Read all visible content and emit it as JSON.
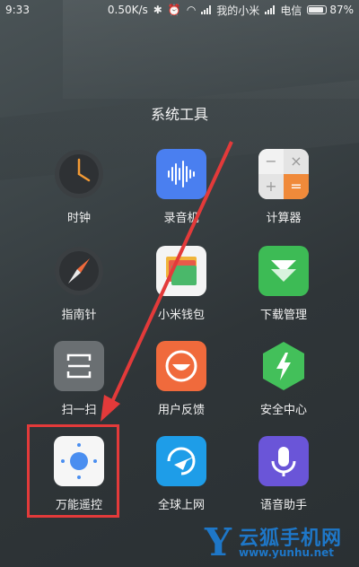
{
  "status": {
    "time": "9:33",
    "speed": "0.50K/s",
    "carrier1": "我的小米",
    "carrier2": "电信",
    "battery": "87%",
    "battery_level": 87
  },
  "folder": {
    "title": "系统工具"
  },
  "apps": [
    {
      "label": "时钟",
      "icon": "clock-icon"
    },
    {
      "label": "录音机",
      "icon": "recorder-icon"
    },
    {
      "label": "计算器",
      "icon": "calculator-icon"
    },
    {
      "label": "指南针",
      "icon": "compass-icon"
    },
    {
      "label": "小米钱包",
      "icon": "wallet-icon"
    },
    {
      "label": "下载管理",
      "icon": "download-icon"
    },
    {
      "label": "扫一扫",
      "icon": "scan-icon"
    },
    {
      "label": "用户反馈",
      "icon": "feedback-icon"
    },
    {
      "label": "安全中心",
      "icon": "security-icon"
    },
    {
      "label": "万能遥控",
      "icon": "remote-control-icon"
    },
    {
      "label": "全球上网",
      "icon": "global-internet-icon"
    },
    {
      "label": "语音助手",
      "icon": "voice-assistant-icon"
    }
  ],
  "calculator": {
    "minus": "−",
    "times": "×",
    "plus": "+",
    "equals": "="
  },
  "watermark": {
    "letter": "Y",
    "name": "云狐手机网",
    "url": "www.yunhu.net"
  },
  "colors": {
    "annotation": "#e33a3a",
    "recorder": "#4a7ff0",
    "download": "#3dbb55",
    "feedback": "#f06a3c",
    "security": "#43c05a",
    "global": "#1e9de8",
    "voice": "#6a55d8"
  }
}
